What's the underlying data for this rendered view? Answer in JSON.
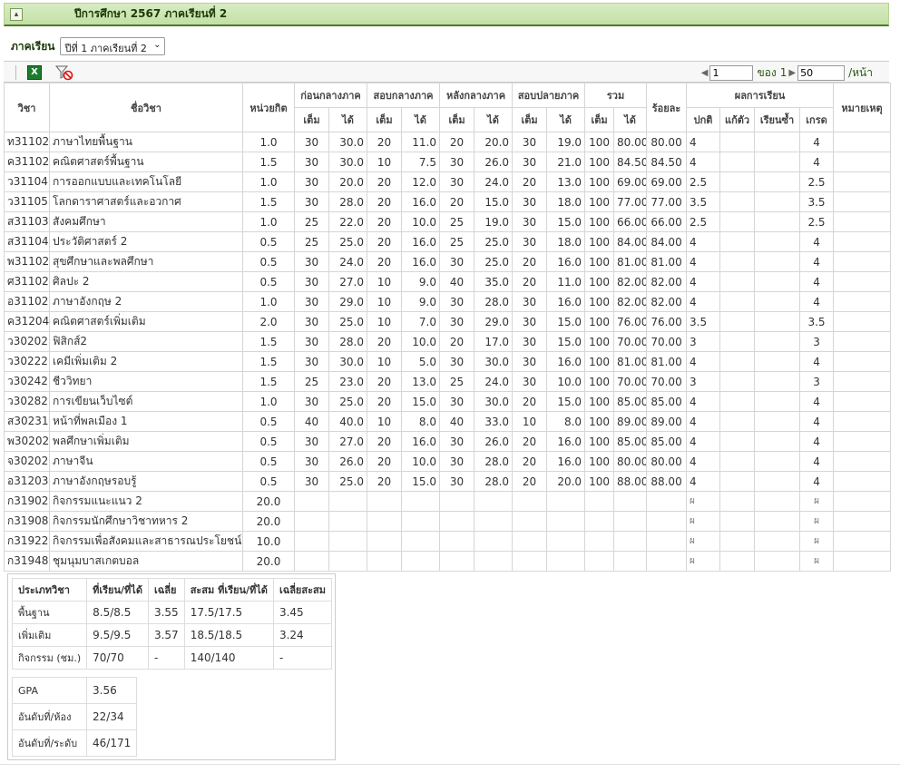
{
  "header": {
    "collapse_icon": "collapse-up-icon",
    "title": "ปีการศึกษา 2567 ภาคเรียนที่ 2"
  },
  "semester": {
    "label": "ภาคเรียน",
    "selected": "ปีที่ 1 ภาคเรียนที่ 2"
  },
  "toolbar": {
    "export_icon": "excel-export-icon",
    "filter_icon": "clear-filter-icon",
    "pager": {
      "page": "1",
      "of_label": "ของ",
      "total_pages": "1",
      "page_size": "50",
      "per_page_label": "/หน้า"
    }
  },
  "table": {
    "headers": {
      "code": "วิชา",
      "name": "ชื่อวิชา",
      "credit": "หน่วยกิต",
      "g1": "ก่อนกลางภาค",
      "g2": "สอบกลางภาค",
      "g3": "หลังกลางภาค",
      "g4": "สอบปลายภาค",
      "g5": "รวม",
      "full": "เต็ม",
      "got": "ได้",
      "percent": "ร้อยละ",
      "result": "ผลการเรียน",
      "normal": "ปกติ",
      "fix": "แก้ตัว",
      "repeat": "เรียนซ้ำ",
      "grade": "เกรด",
      "note": "หมายเหตุ"
    },
    "rows": [
      {
        "code": "ท31102",
        "name": "ภาษาไทยพื้นฐาน",
        "credit": "1.0",
        "bf": "30",
        "bg": "30.0",
        "mf": "20",
        "mg": "11.0",
        "af": "20",
        "ag": "20.0",
        "ff": "30",
        "fg": "19.0",
        "tf": "100",
        "tg": "80.00",
        "pct": "80.00",
        "normal": "4",
        "fix": "",
        "repeat": "",
        "grade": "4",
        "note": ""
      },
      {
        "code": "ค31102",
        "name": "คณิตศาสตร์พื้นฐาน",
        "credit": "1.5",
        "bf": "30",
        "bg": "30.0",
        "mf": "10",
        "mg": "7.5",
        "af": "30",
        "ag": "26.0",
        "ff": "30",
        "fg": "21.0",
        "tf": "100",
        "tg": "84.50",
        "pct": "84.50",
        "normal": "4",
        "fix": "",
        "repeat": "",
        "grade": "4",
        "note": ""
      },
      {
        "code": "ว31104",
        "name": "การออกแบบและเทคโนโลยี",
        "credit": "1.0",
        "bf": "30",
        "bg": "20.0",
        "mf": "20",
        "mg": "12.0",
        "af": "30",
        "ag": "24.0",
        "ff": "20",
        "fg": "13.0",
        "tf": "100",
        "tg": "69.00",
        "pct": "69.00",
        "normal": "2.5",
        "fix": "",
        "repeat": "",
        "grade": "2.5",
        "note": ""
      },
      {
        "code": "ว31105",
        "name": "โลกดาราศาสตร์และอวกาศ",
        "credit": "1.5",
        "bf": "30",
        "bg": "28.0",
        "mf": "20",
        "mg": "16.0",
        "af": "20",
        "ag": "15.0",
        "ff": "30",
        "fg": "18.0",
        "tf": "100",
        "tg": "77.00",
        "pct": "77.00",
        "normal": "3.5",
        "fix": "",
        "repeat": "",
        "grade": "3.5",
        "note": ""
      },
      {
        "code": "ส31103",
        "name": "สังคมศึกษา",
        "credit": "1.0",
        "bf": "25",
        "bg": "22.0",
        "mf": "20",
        "mg": "10.0",
        "af": "25",
        "ag": "19.0",
        "ff": "30",
        "fg": "15.0",
        "tf": "100",
        "tg": "66.00",
        "pct": "66.00",
        "normal": "2.5",
        "fix": "",
        "repeat": "",
        "grade": "2.5",
        "note": ""
      },
      {
        "code": "ส31104",
        "name": "ประวัติศาสตร์ 2",
        "credit": "0.5",
        "bf": "25",
        "bg": "25.0",
        "mf": "20",
        "mg": "16.0",
        "af": "25",
        "ag": "25.0",
        "ff": "30",
        "fg": "18.0",
        "tf": "100",
        "tg": "84.00",
        "pct": "84.00",
        "normal": "4",
        "fix": "",
        "repeat": "",
        "grade": "4",
        "note": ""
      },
      {
        "code": "พ31102",
        "name": "สุขศึกษาและพลศึกษา",
        "credit": "0.5",
        "bf": "30",
        "bg": "24.0",
        "mf": "20",
        "mg": "16.0",
        "af": "30",
        "ag": "25.0",
        "ff": "20",
        "fg": "16.0",
        "tf": "100",
        "tg": "81.00",
        "pct": "81.00",
        "normal": "4",
        "fix": "",
        "repeat": "",
        "grade": "4",
        "note": ""
      },
      {
        "code": "ศ31102",
        "name": "ศิลปะ 2",
        "credit": "0.5",
        "bf": "30",
        "bg": "27.0",
        "mf": "10",
        "mg": "9.0",
        "af": "40",
        "ag": "35.0",
        "ff": "20",
        "fg": "11.0",
        "tf": "100",
        "tg": "82.00",
        "pct": "82.00",
        "normal": "4",
        "fix": "",
        "repeat": "",
        "grade": "4",
        "note": ""
      },
      {
        "code": "อ31102",
        "name": "ภาษาอังกฤษ 2",
        "credit": "1.0",
        "bf": "30",
        "bg": "29.0",
        "mf": "10",
        "mg": "9.0",
        "af": "30",
        "ag": "28.0",
        "ff": "30",
        "fg": "16.0",
        "tf": "100",
        "tg": "82.00",
        "pct": "82.00",
        "normal": "4",
        "fix": "",
        "repeat": "",
        "grade": "4",
        "note": ""
      },
      {
        "code": "ค31204",
        "name": "คณิตศาสตร์เพิ่มเติม",
        "credit": "2.0",
        "bf": "30",
        "bg": "25.0",
        "mf": "10",
        "mg": "7.0",
        "af": "30",
        "ag": "29.0",
        "ff": "30",
        "fg": "15.0",
        "tf": "100",
        "tg": "76.00",
        "pct": "76.00",
        "normal": "3.5",
        "fix": "",
        "repeat": "",
        "grade": "3.5",
        "note": ""
      },
      {
        "code": "ว30202",
        "name": "ฟิสิกส์2",
        "credit": "1.5",
        "bf": "30",
        "bg": "28.0",
        "mf": "20",
        "mg": "10.0",
        "af": "20",
        "ag": "17.0",
        "ff": "30",
        "fg": "15.0",
        "tf": "100",
        "tg": "70.00",
        "pct": "70.00",
        "normal": "3",
        "fix": "",
        "repeat": "",
        "grade": "3",
        "note": ""
      },
      {
        "code": "ว30222",
        "name": "เคมีเพิ่มเติม 2",
        "credit": "1.5",
        "bf": "30",
        "bg": "30.0",
        "mf": "10",
        "mg": "5.0",
        "af": "30",
        "ag": "30.0",
        "ff": "30",
        "fg": "16.0",
        "tf": "100",
        "tg": "81.00",
        "pct": "81.00",
        "normal": "4",
        "fix": "",
        "repeat": "",
        "grade": "4",
        "note": ""
      },
      {
        "code": "ว30242",
        "name": "ชีววิทยา",
        "credit": "1.5",
        "bf": "25",
        "bg": "23.0",
        "mf": "20",
        "mg": "13.0",
        "af": "25",
        "ag": "24.0",
        "ff": "30",
        "fg": "10.0",
        "tf": "100",
        "tg": "70.00",
        "pct": "70.00",
        "normal": "3",
        "fix": "",
        "repeat": "",
        "grade": "3",
        "note": ""
      },
      {
        "code": "ว30282",
        "name": "การเขียนเว็บไซต์",
        "credit": "1.0",
        "bf": "30",
        "bg": "25.0",
        "mf": "20",
        "mg": "15.0",
        "af": "30",
        "ag": "30.0",
        "ff": "20",
        "fg": "15.0",
        "tf": "100",
        "tg": "85.00",
        "pct": "85.00",
        "normal": "4",
        "fix": "",
        "repeat": "",
        "grade": "4",
        "note": ""
      },
      {
        "code": "ส30231",
        "name": "หน้าที่พลเมือง 1",
        "credit": "0.5",
        "bf": "40",
        "bg": "40.0",
        "mf": "10",
        "mg": "8.0",
        "af": "40",
        "ag": "33.0",
        "ff": "10",
        "fg": "8.0",
        "tf": "100",
        "tg": "89.00",
        "pct": "89.00",
        "normal": "4",
        "fix": "",
        "repeat": "",
        "grade": "4",
        "note": ""
      },
      {
        "code": "พ30202",
        "name": "พลศึกษาเพิ่มเติม",
        "credit": "0.5",
        "bf": "30",
        "bg": "27.0",
        "mf": "20",
        "mg": "16.0",
        "af": "30",
        "ag": "26.0",
        "ff": "20",
        "fg": "16.0",
        "tf": "100",
        "tg": "85.00",
        "pct": "85.00",
        "normal": "4",
        "fix": "",
        "repeat": "",
        "grade": "4",
        "note": ""
      },
      {
        "code": "จ30202",
        "name": "ภาษาจีน",
        "credit": "0.5",
        "bf": "30",
        "bg": "26.0",
        "mf": "20",
        "mg": "10.0",
        "af": "30",
        "ag": "28.0",
        "ff": "20",
        "fg": "16.0",
        "tf": "100",
        "tg": "80.00",
        "pct": "80.00",
        "normal": "4",
        "fix": "",
        "repeat": "",
        "grade": "4",
        "note": ""
      },
      {
        "code": "อ31203",
        "name": "ภาษาอังกฤษรอบรู้",
        "credit": "0.5",
        "bf": "30",
        "bg": "25.0",
        "mf": "20",
        "mg": "15.0",
        "af": "30",
        "ag": "28.0",
        "ff": "20",
        "fg": "20.0",
        "tf": "100",
        "tg": "88.00",
        "pct": "88.00",
        "normal": "4",
        "fix": "",
        "repeat": "",
        "grade": "4",
        "note": ""
      },
      {
        "code": "ก31902",
        "name": "กิจกรรมแนะแนว 2",
        "credit": "20.0",
        "bf": "",
        "bg": "",
        "mf": "",
        "mg": "",
        "af": "",
        "ag": "",
        "ff": "",
        "fg": "",
        "tf": "",
        "tg": "",
        "pct": "",
        "normal": "ผ",
        "fix": "",
        "repeat": "",
        "grade": "ผ",
        "note": ""
      },
      {
        "code": "ก31908",
        "name": "กิจกรรมนักศึกษาวิชาทหาร 2",
        "credit": "20.0",
        "bf": "",
        "bg": "",
        "mf": "",
        "mg": "",
        "af": "",
        "ag": "",
        "ff": "",
        "fg": "",
        "tf": "",
        "tg": "",
        "pct": "",
        "normal": "ผ",
        "fix": "",
        "repeat": "",
        "grade": "ผ",
        "note": ""
      },
      {
        "code": "ก31922",
        "name": "กิจกรรมเพื่อสังคมและสาธารณประโยชน์ 2",
        "credit": "10.0",
        "bf": "",
        "bg": "",
        "mf": "",
        "mg": "",
        "af": "",
        "ag": "",
        "ff": "",
        "fg": "",
        "tf": "",
        "tg": "",
        "pct": "",
        "normal": "ผ",
        "fix": "",
        "repeat": "",
        "grade": "ผ",
        "note": ""
      },
      {
        "code": "ก31948",
        "name": "ชุมนุมบาสเกตบอล",
        "credit": "20.0",
        "bf": "",
        "bg": "",
        "mf": "",
        "mg": "",
        "af": "",
        "ag": "",
        "ff": "",
        "fg": "",
        "tf": "",
        "tg": "",
        "pct": "",
        "normal": "ผ",
        "fix": "",
        "repeat": "",
        "grade": "ผ",
        "note": ""
      }
    ]
  },
  "summary": {
    "headers": [
      "ประเภทวิชา",
      "ที่เรียน/ที่ได้",
      "เฉลี่ย",
      "สะสม ที่เรียน/ที่ได้",
      "เฉลี่ยสะสม"
    ],
    "rows": [
      [
        "พื้นฐาน",
        "8.5/8.5",
        "3.55",
        "17.5/17.5",
        "3.45"
      ],
      [
        "เพิ่มเติม",
        "9.5/9.5",
        "3.57",
        "18.5/18.5",
        "3.24"
      ],
      [
        "กิจกรรม (ชม.)",
        "70/70",
        "-",
        "140/140",
        "-"
      ]
    ],
    "stats": [
      {
        "label": "GPA",
        "value": "3.56"
      },
      {
        "label": "อันดับที่/ห้อง",
        "value": "22/34"
      },
      {
        "label": "อันดับที่/ระดับ",
        "value": "46/171"
      }
    ]
  }
}
